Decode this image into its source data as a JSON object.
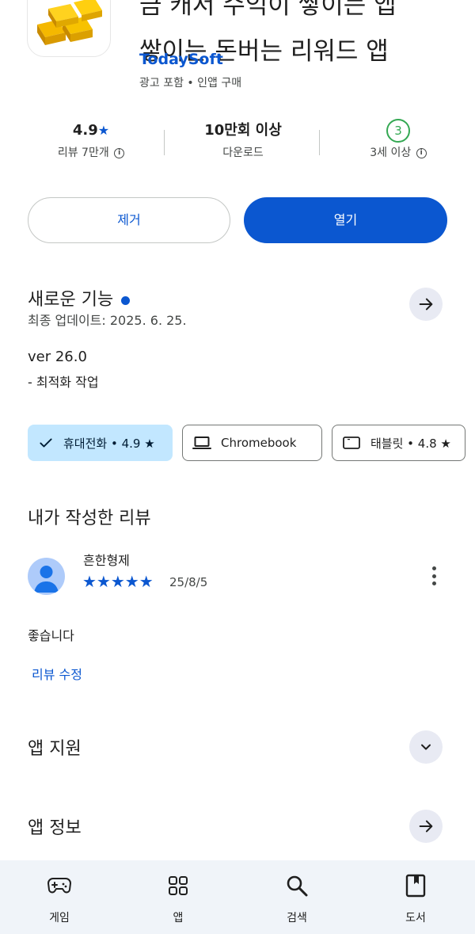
{
  "app": {
    "title_line1": "쌓이는 돈버는 리워드 앱",
    "title_line0": "금 캐서 수익이 쌓이는 앱",
    "developer": "TodaySoft",
    "meta": "광고 포함 • 인앱 구매"
  },
  "stats": {
    "rating": {
      "value": "4.9",
      "label": "리뷰 7만개"
    },
    "downloads": {
      "value": "10만회 이상",
      "label": "다운로드"
    },
    "age": {
      "badge": "3",
      "label": "3세 이상"
    }
  },
  "actions": {
    "remove_label": "제거",
    "open_label": "열기"
  },
  "whats_new": {
    "title": "새로운 기능",
    "updated": "최종 업데이트: 2025. 6. 25.",
    "version": "ver 26.0",
    "note": "- 최적화 작업"
  },
  "devices": [
    {
      "label": "휴대전화 • 4.9 ★",
      "icon": "check-icon",
      "selected": true
    },
    {
      "label": "Chromebook",
      "icon": "laptop-icon",
      "selected": false
    },
    {
      "label": "태블릿 • 4.8 ★",
      "icon": "tablet-icon",
      "selected": false
    }
  ],
  "my_review": {
    "title": "내가 작성한 리뷰",
    "reviewer": "흔한형제",
    "stars": "★★★★★",
    "rating": 5,
    "date": "25/8/5",
    "text": "좋습니다",
    "edit_label": "리뷰 수정"
  },
  "sections": {
    "app_support": "앱 지원",
    "app_info": "앱 정보"
  },
  "nav": [
    {
      "label": "게임",
      "icon": "gamepad-icon"
    },
    {
      "label": "앱",
      "icon": "apps-grid-icon"
    },
    {
      "label": "검색",
      "icon": "search-icon"
    },
    {
      "label": "도서",
      "icon": "book-icon"
    }
  ],
  "colors": {
    "accent": "#0b57d0",
    "chip_selected": "#c2e7ff",
    "nav_bg": "#f0f4f9",
    "age_green": "#34a853"
  }
}
